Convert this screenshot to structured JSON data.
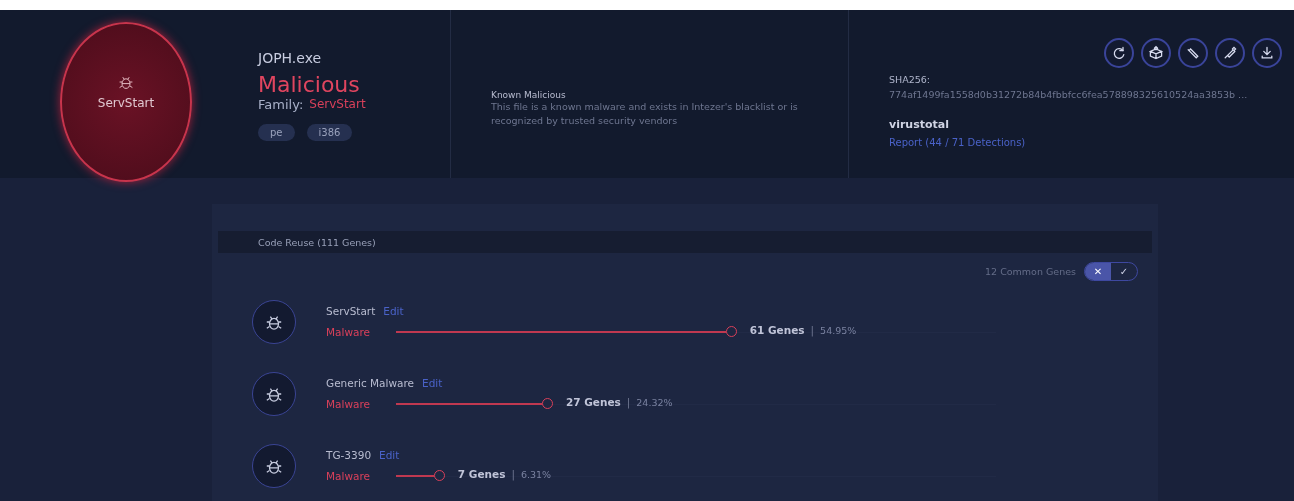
{
  "file": {
    "name": "JOPH.exe",
    "verdict": "Malicious",
    "family_label": "Family:",
    "family": "ServStart",
    "tags": [
      "pe",
      "i386"
    ],
    "badge": "ServStart"
  },
  "verdict_info": {
    "title": "Known Malicious",
    "description": "This file is a known malware and exists in Intezer's blacklist or is recognized by trusted security vendors"
  },
  "hash": {
    "label": "SHA256:",
    "value": "774af1499fa1558d0b31272b84b4fbbfcc6fea578898325610524aa3853b  ..."
  },
  "virustotal": {
    "title": "virustotal",
    "link": "Report (44 / 71 Detections)"
  },
  "actions": [
    {
      "kind": "refresh"
    },
    {
      "kind": "box"
    },
    {
      "kind": "edit"
    },
    {
      "kind": "syringe"
    },
    {
      "kind": "download"
    }
  ],
  "code_reuse": {
    "title": "Code Reuse",
    "count": "(111 Genes)",
    "common_label": "12 Common Genes",
    "common_on": false,
    "toggle_off": "✕",
    "toggle_on": "✓",
    "separator": "|",
    "families": [
      {
        "name": "ServStart",
        "edit": "Edit",
        "type": "Malware",
        "level": 0.5495,
        "genes": "61 Genes",
        "percent": "54.95%"
      },
      {
        "name": "Generic Malware",
        "edit": "Edit",
        "type": "Malware",
        "level": 0.2432,
        "genes": "27 Genes",
        "percent": "24.32%"
      },
      {
        "name": "TG-3390",
        "edit": "Edit",
        "type": "Malware",
        "level": 0.0631,
        "genes": "7 Genes",
        "percent": "6.31%"
      }
    ]
  }
}
